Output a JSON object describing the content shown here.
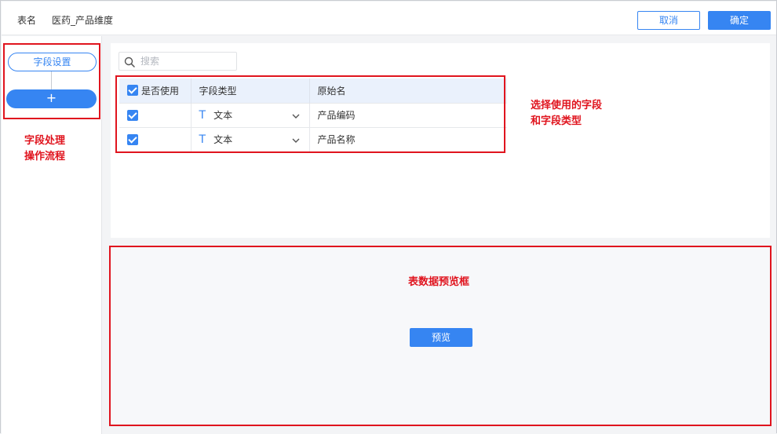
{
  "header": {
    "table_label": "表名",
    "table_name": "医药_产品维度",
    "cancel_label": "取消",
    "confirm_label": "确定"
  },
  "left_panel": {
    "step_label": "字段设置",
    "add_label": "+"
  },
  "search": {
    "placeholder": "搜索",
    "value": ""
  },
  "fields_table": {
    "columns": [
      "是否使用",
      "字段类型",
      "原始名"
    ],
    "rows": [
      {
        "used": true,
        "type_icon": "T",
        "type": "文本",
        "original_name": "产品编码"
      },
      {
        "used": true,
        "type_icon": "T",
        "type": "文本",
        "original_name": "产品名称"
      }
    ]
  },
  "preview": {
    "button_label": "预览"
  },
  "annotations": {
    "left_note_line1": "字段处理",
    "left_note_line2": "操作流程",
    "table_note_line1": "选择使用的字段",
    "table_note_line2": "和字段类型",
    "preview_note": "表数据预览框"
  },
  "colors": {
    "primary": "#3685f2",
    "annotation_red": "#e0141e",
    "table_header_bg": "#eaf1fc"
  }
}
